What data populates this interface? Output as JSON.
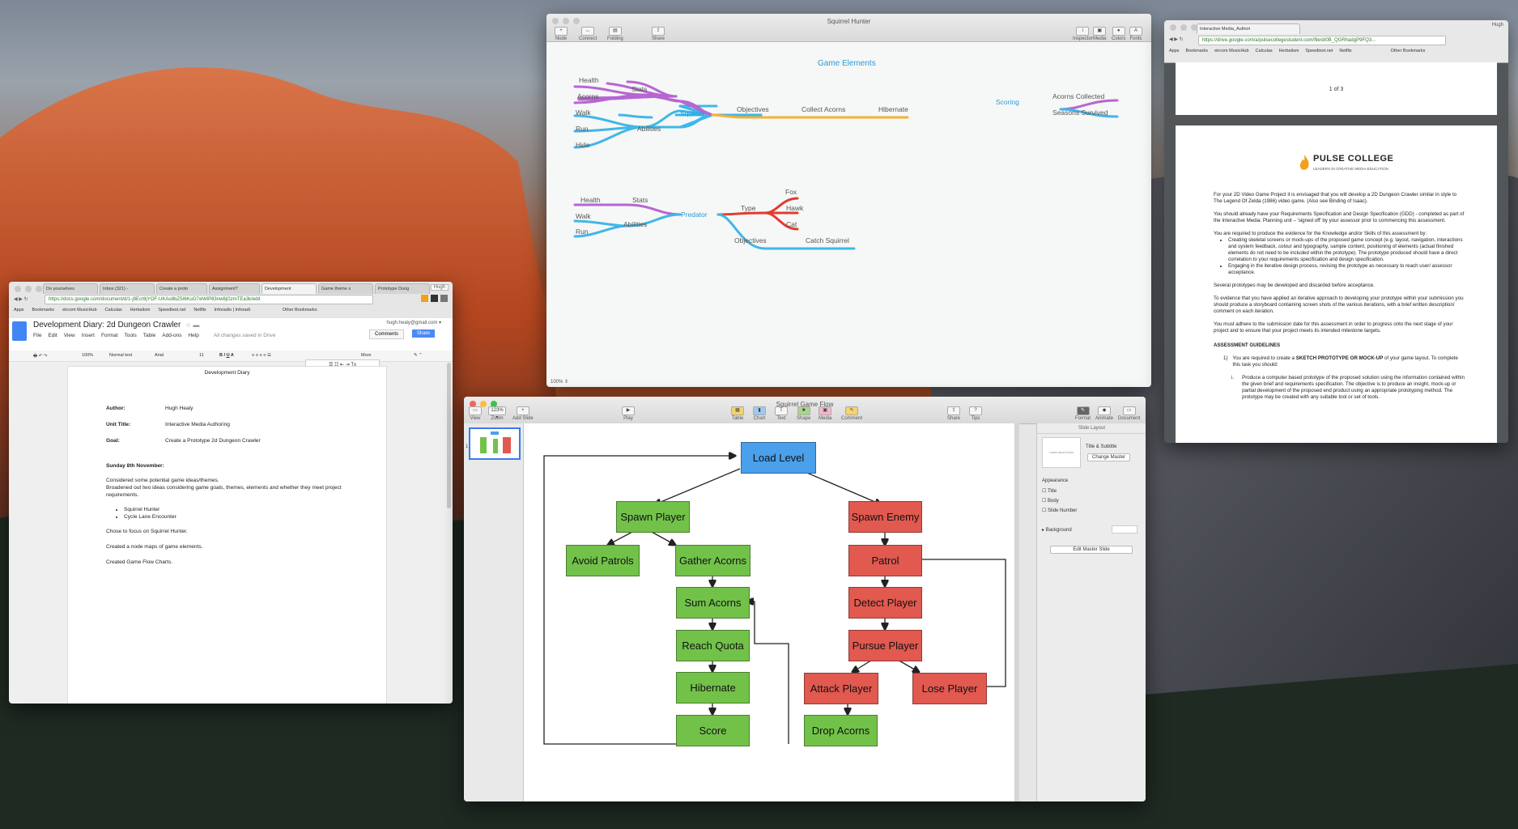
{
  "background": {
    "description_colors": [
      "#a34c28",
      "#c65f2c",
      "#1b231d"
    ]
  },
  "mindmap_window": {
    "title": "Squirrel Hunter",
    "toolbar": [
      "Node",
      "Connect",
      "Folding",
      "Share",
      "Inspector",
      "Media",
      "Colors",
      "Fonts"
    ],
    "zoom": "100% ⇕",
    "heading": "Game Elements",
    "squirrel": {
      "label": "Squirrel",
      "stats": "Stats",
      "health": "Health",
      "acorns": "Acorns",
      "abilities": "Abilities",
      "walk": "Walk",
      "run": "Run",
      "hide": "Hide",
      "objectives": "Objectives",
      "collect": "Collect Acorns",
      "hibernate": "Hibernate"
    },
    "scoring": {
      "label": "Scoring",
      "collected": "Acorns Collected",
      "seasons": "Seasons Survived"
    },
    "predator": {
      "label": "Predator",
      "stats": "Stats",
      "health": "Health",
      "abilities": "Abilities",
      "walk": "Walk",
      "run": "Run",
      "type": "Type",
      "fox": "Fox",
      "hawk": "Hawk",
      "cat": "Cat",
      "objectives": "Objectives",
      "catch": "Catch Squirrel"
    },
    "colors": {
      "purple": "#b666d2",
      "blue": "#3fb7e8",
      "orange": "#f2b233",
      "red": "#e23b2e"
    }
  },
  "keynote_window": {
    "title": "Squirrel Game Flow",
    "toolbar_left": [
      "View",
      "Zoom",
      "Add Slide"
    ],
    "zoom_value": "123% ▾",
    "toolbar_play": "Play",
    "toolbar_mid": [
      "Table",
      "Chart",
      "Text",
      "Shape",
      "Media",
      "Comment"
    ],
    "toolbar_right": [
      "Share",
      "Tips",
      "Format",
      "Animate",
      "Document"
    ],
    "slide_number": "1",
    "inspector": {
      "header": "Slide Layout",
      "layout_name": "Title & Subtitle",
      "change_master": "Change Master",
      "appearance": "Appearance",
      "checks": [
        "Title",
        "Body",
        "Slide Number"
      ],
      "background": "Background",
      "edit_master": "Edit Master Slide",
      "thumb": "Lorem Ipsum Dolor"
    },
    "flow": {
      "load": "Load Level",
      "spawn_player": "Spawn Player",
      "avoid": "Avoid Patrols",
      "gather": "Gather Acorns",
      "sum": "Sum Acorns",
      "reach": "Reach Quota",
      "hibernate": "Hibernate",
      "score": "Score",
      "spawn_enemy": "Spawn Enemy",
      "patrol": "Patrol",
      "detect": "Detect Player",
      "pursue": "Pursue Player",
      "attack": "Attack Player",
      "lose": "Lose Player",
      "drop": "Drop Acorns"
    },
    "colors": {
      "green": "#72c24a",
      "red": "#e1594f",
      "blue": "#4aa0ea"
    }
  },
  "docs_window": {
    "tabs": [
      "Do yourselves",
      "Inbox (321) -",
      "Create a proto",
      "Assignment?",
      "Development",
      "Game theme s",
      "Prototype Dung"
    ],
    "user_chip": "Hugh",
    "url": "https://docs.google.com/document/d/1-j9Ecr8jYOF-UKAo8bZ5I6KuO7wWiP83nw8jGzmTEa3k/edit",
    "bookmarks": [
      "Apps",
      "Bookmarks",
      "eircom MusicHub",
      "Calculas",
      "Herbalism",
      "Speedtest.net",
      "Netflix",
      "Inforadio | Inforadi",
      "Other Bookmarks"
    ],
    "doc_title": "Development Diary: 2d Dungeon Crawler",
    "menus": [
      "File",
      "Edit",
      "View",
      "Insert",
      "Format",
      "Tools",
      "Table",
      "Add-ons",
      "Help"
    ],
    "saved": "All changes saved in Drive",
    "email": "hugh.healy@gmail.com ▾",
    "comments": "Comments",
    "share": "Share",
    "fmt": {
      "zoom": "100%",
      "style": "Normal text",
      "font": "Arial",
      "size": "11",
      "more": "More"
    },
    "page": {
      "heading": "Development Diary",
      "author_label": "Author:",
      "author": "Hugh Healy",
      "unit_label": "Unit Title:",
      "unit": "Interactive Media Authoring",
      "goal_label": "Goal:",
      "goal": "Create a Prototype 2d Dungeon Crawler",
      "date": "Sunday 8th November:",
      "p1": "Considered some potential game ideas/themes.",
      "p2": "Broadened out two ideas considering game goals, themes, elements and whether they meet project requirements.",
      "b1": "Squirrel Hunter",
      "b2": "Cycle Lane Encounter",
      "p3": "Chose to focus on Squirrel Hunter.",
      "p4": "Created a node maps of game elements.",
      "p5": "Created Game Flow Charts."
    }
  },
  "drive_window": {
    "tab": "Interactive Media_Authori",
    "user_chip": "Hugh",
    "url": "https://drive.google.com/a/pulsecollegestudent.com/file/d/0B_QGRhadgP9FQ3...",
    "bookmarks": [
      "Apps",
      "Bookmarks",
      "eircom MusicHub",
      "Calculas",
      "Herbalism",
      "Speedtest.net",
      "Netflix",
      "Other Bookmarks"
    ],
    "page_count": "1 of 3",
    "logo_title": "PULSE COLLEGE",
    "logo_sub": "LEADERS IN CREATIVE MEDIA EDUCATION",
    "paras": [
      "For your 2D Video Game Project it is envisaged that you will develop a 2D Dungeon Crawler similar in style to The Legend Of Zelda (1986) video game. (Also see Binding of Isaac).",
      "You should already have your Requirements Specification and Design Specification (GDD) - completed as part of the Interactive Media: Planning unit – 'signed off' by your assessor prior to commencing this assessment.",
      "You are required to produce the evidence for the Knowledge and/or Skills of this assessment by:"
    ],
    "bullets": [
      "Creating skeletal screens or mock-ups of the proposed game concept (e.g. layout, navigation, interactions and system feedback, colour and typography, sample content, positioning of elements (actual finished elements do not need to be included within the prototype). The prototype produced should have a direct correlation to your requirements specification and design specification.",
      "Engaging in the iterative design process, revising the prototype as necessary to reach user/ assessor acceptance."
    ],
    "paras2": [
      "Several prototypes may be developed and discarded before acceptance.",
      "To evidence that you have applied an iterative approach to developing your prototype within your submission you should produce a storyboard containing screen shots of the various iterations, with a brief written description/ comment on each iteration.",
      "You must adhere to the submission date for this assessment in order to progress onto the next stage of your project and to ensure that your project meets its intended milestone targets."
    ],
    "guidelines_heading": "ASSESSMENT GUIDELINES",
    "g1_pre": "You are required to create a ",
    "g1_bold": "SKETCH PROTOTYPE OR MOCK-UP",
    "g1_post": " of your game layout. To complete this task you should:",
    "g1_num": "1)",
    "gi_num": "i.",
    "gi": "Produce a computer based prototype of the proposed solution using the information contained within the given brief and requirements specification. The objective is to produce an insight, mock-up or partial development of the proposed end product using an appropriate prototyping method. The prototype may be created with any suitable tool or set of tools."
  }
}
